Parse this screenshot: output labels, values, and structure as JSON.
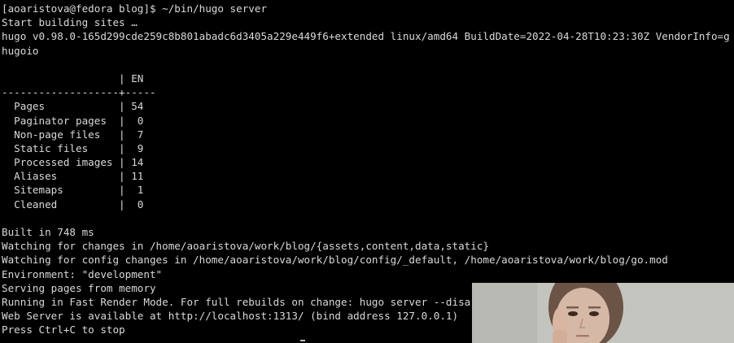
{
  "terminal": {
    "lines": [
      "[aoaristova@fedora blog]$ ~/bin/hugo server",
      "Start building sites …",
      "hugo v0.98.0-165d299cde259c8b801abadc6d3405a229e449f6+extended linux/amd64 BuildDate=2022-04-28T10:23:30Z VendorInfo=g",
      "hugoio",
      "",
      "                   | EN",
      "-------------------+-----",
      "  Pages            | 54",
      "  Paginator pages  |  0",
      "  Non-page files   |  7",
      "  Static files     |  9",
      "  Processed images | 14",
      "  Aliases          | 11",
      "  Sitemaps         |  1",
      "  Cleaned          |  0",
      "",
      "Built in 748 ms",
      "Watching for changes in /home/aoaristova/work/blog/{assets,content,data,static}",
      "Watching for config changes in /home/aoaristova/work/blog/config/_default, /home/aoaristova/work/blog/go.mod",
      "Environment: \"development\"",
      "Serving pages from memory",
      "Running in Fast Render Mode. For full rebuilds on change: hugo server --disa",
      "Web Server is available at http://localhost:1313/ (bind address 127.0.0.1)",
      "Press Ctrl+C to stop"
    ]
  },
  "colors": {
    "background": "#000000",
    "text": "#d9d9d9"
  },
  "overlay": {
    "icon": "webcam-person-icon"
  }
}
